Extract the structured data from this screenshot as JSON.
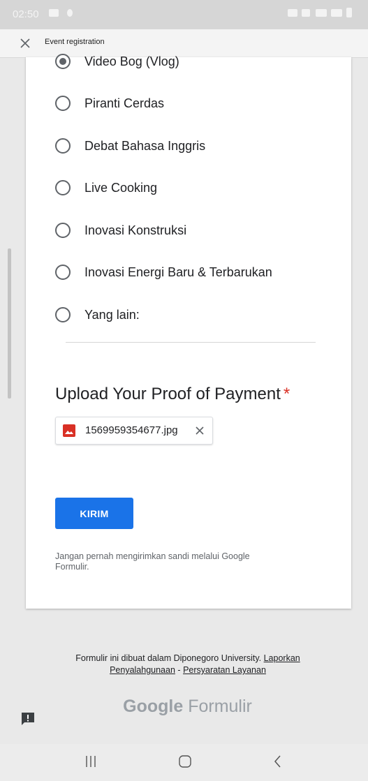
{
  "status_bar": {
    "time": "02:50"
  },
  "app_bar": {
    "title": "Event registration"
  },
  "options": [
    {
      "label": "Video Bog (Vlog)",
      "checked": true
    },
    {
      "label": "Piranti Cerdas",
      "checked": false
    },
    {
      "label": "Debat Bahasa Inggris",
      "checked": false
    },
    {
      "label": "Live Cooking",
      "checked": false
    },
    {
      "label": "Inovasi Konstruksi",
      "checked": false
    },
    {
      "label": "Inovasi Energi Baru & Terbarukan",
      "checked": false
    },
    {
      "label": "Yang lain:",
      "checked": false
    }
  ],
  "upload": {
    "title": "Upload Your Proof of Payment",
    "required_mark": "*",
    "file_name": "1569959354677.jpg"
  },
  "submit_label": "KIRIM",
  "warning": "Jangan pernah mengirimkan sandi melalui Google Formulir.",
  "footer": {
    "text": "Formulir ini dibuat dalam Diponegoro University.",
    "link_report": "Laporkan Penyalahgunaan",
    "separator": "-",
    "link_terms": "Persyaratan Layanan"
  },
  "brand": {
    "google": "Google",
    "product": "Formulir"
  },
  "colors": {
    "accent": "#1a73e8",
    "required": "#d93025",
    "file_icon": "#d93025"
  },
  "icons": [
    "close-icon",
    "image-file-icon",
    "remove-file-icon",
    "feedback-icon",
    "recents-icon",
    "home-icon",
    "back-icon"
  ]
}
